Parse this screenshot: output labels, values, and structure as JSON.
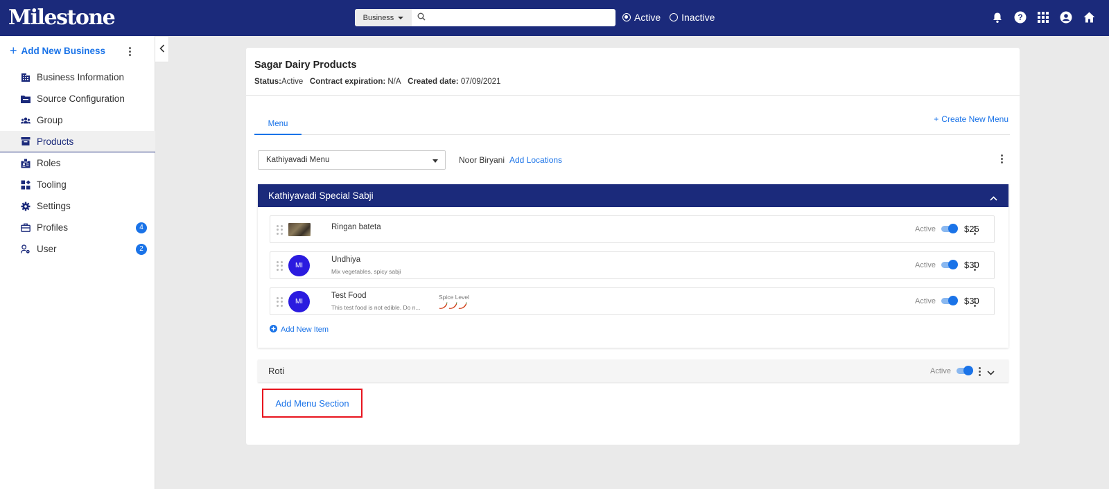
{
  "app": {
    "logo": "Milestone"
  },
  "search": {
    "scope": "Business",
    "placeholder": "",
    "value": ""
  },
  "status_filter": {
    "options": [
      "Active",
      "Inactive"
    ],
    "selected": "Active"
  },
  "top_icons": [
    "bell-icon",
    "help-icon",
    "apps-grid-icon",
    "account-icon",
    "home-icon"
  ],
  "sidebar": {
    "add_label": "Add New Business",
    "items": [
      {
        "label": "Business Information",
        "icon": "building-icon"
      },
      {
        "label": "Source Configuration",
        "icon": "folder-icon"
      },
      {
        "label": "Group",
        "icon": "group-icon"
      },
      {
        "label": "Products",
        "icon": "archive-icon",
        "active": true
      },
      {
        "label": "Roles",
        "icon": "badge-icon"
      },
      {
        "label": "Tooling",
        "icon": "widgets-icon"
      },
      {
        "label": "Settings",
        "icon": "gear-icon"
      },
      {
        "label": "Profiles",
        "icon": "briefcase-icon",
        "count": "4"
      },
      {
        "label": "User",
        "icon": "user-settings-icon",
        "count": "2"
      }
    ]
  },
  "business": {
    "name": "Sagar Dairy Products",
    "status_label": "Status:",
    "status_value": "Active",
    "contract_label": "Contract expiration:",
    "contract_value": "N/A",
    "created_label": "Created date:",
    "created_value": "07/09/2021"
  },
  "tabs": {
    "menu": "Menu",
    "create_menu": "Create New Menu"
  },
  "menu_select": {
    "value": "Kathiyavadi Menu"
  },
  "location": {
    "name": "Noor Biryani",
    "add_label": "Add Locations"
  },
  "sections": [
    {
      "title": "Kathiyavadi Special Sabji",
      "expanded": true,
      "items": [
        {
          "name": "Ringan bateta",
          "description": "",
          "thumb": "image",
          "active_label": "Active",
          "price": "$25"
        },
        {
          "name": "Undhiya",
          "description": "Mix vegetables, spicy sabji",
          "thumb": "MI",
          "active_label": "Active",
          "price": "$30"
        },
        {
          "name": "Test Food",
          "description": "This test food is not edible. Do n...",
          "thumb": "MI",
          "spice_label": "Spice Level",
          "spice_level": 3,
          "active_label": "Active",
          "price": "$30"
        }
      ],
      "add_item_label": "Add New Item"
    },
    {
      "title": "Roti",
      "expanded": false,
      "active_label": "Active"
    }
  ],
  "add_section_label": "Add Menu Section",
  "colors": {
    "brand": "#1b2a7b",
    "accent": "#1a73e8",
    "highlight": "#e8141e",
    "avatar": "#2b1bdf"
  }
}
